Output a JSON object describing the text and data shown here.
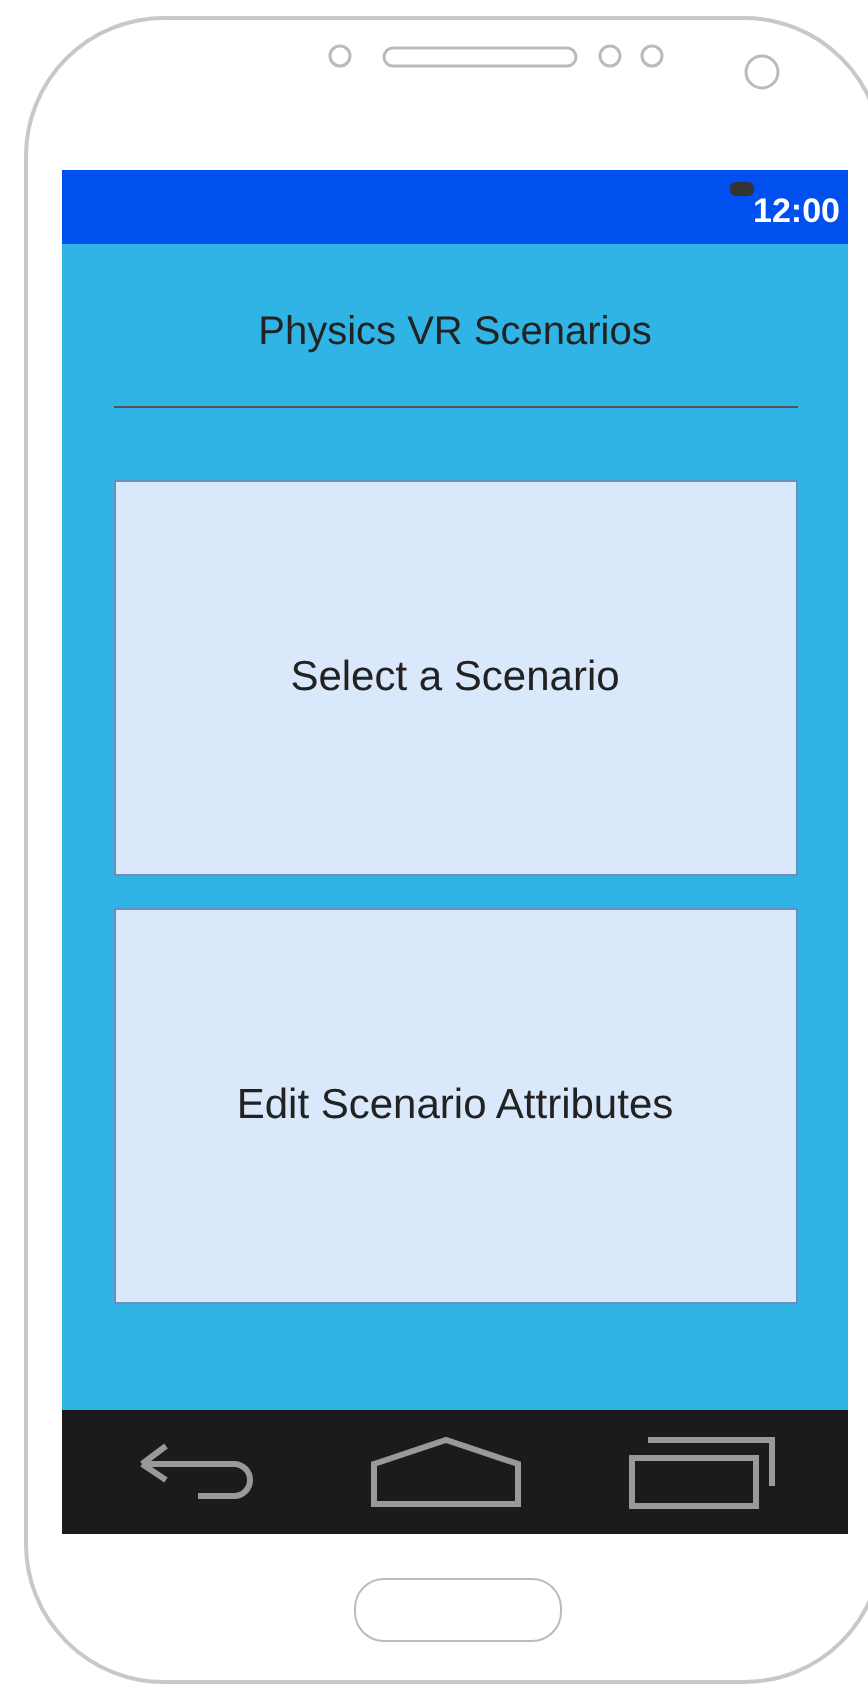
{
  "status_bar": {
    "time": "12:00"
  },
  "header": {
    "title": "Physics VR Scenarios"
  },
  "buttons": [
    {
      "label": "Select a Scenario"
    },
    {
      "label": "Edit Scenario Attributes"
    }
  ]
}
